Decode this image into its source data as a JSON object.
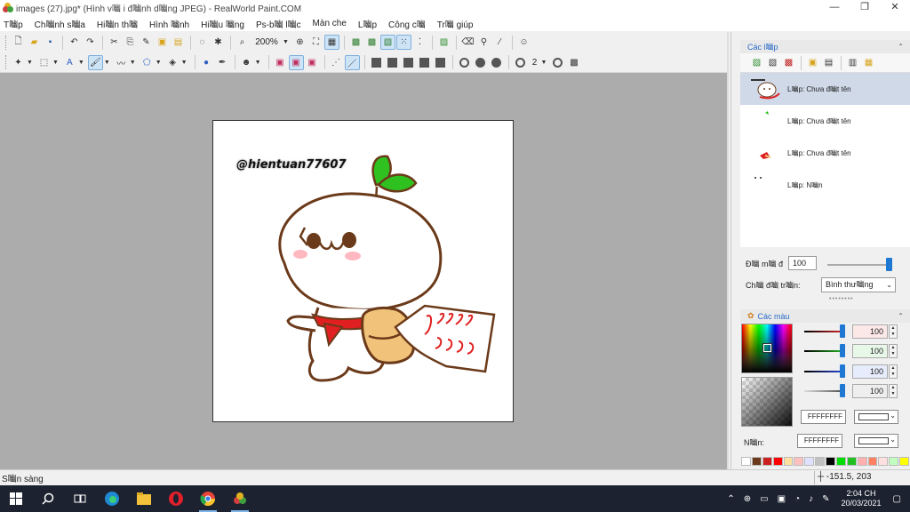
{
  "window": {
    "title": "images (27).jpg* (Hình v㗀 i đ㗀nh d㗀ng JPEG) - RealWorld Paint.COM",
    "controls": [
      "—",
      "❐",
      "✕"
    ]
  },
  "menu": [
    "T㗀p",
    "Ch㗀nh s㗀a",
    "Hi㗀n th㗀",
    "Hình 㗀nh",
    "Hi㗀u 㗀ng",
    "Ps-b㗀 l㗀c",
    "Màn che",
    "L㗀p",
    "Công c㗀",
    "Tr㗀 giúp"
  ],
  "toolbar1": {
    "zoom": "200%"
  },
  "toolbar2": {
    "brush_width": "2"
  },
  "canvas": {
    "watermark": "@hientuan77607"
  },
  "layers_panel": {
    "title": "Các l㗀p",
    "layers": [
      {
        "name": "L㗀p: Chưa đ㗀t tên",
        "selected": true
      },
      {
        "name": "L㗀p: Chưa đ㗀t tên",
        "selected": false
      },
      {
        "name": "L㗀p: Chưa đ㗀t tên",
        "selected": false
      },
      {
        "name": "L㗀p: N㗀n",
        "selected": false
      }
    ],
    "opacity_label": "Đ㗀 m㗀 đ",
    "opacity_value": "100",
    "blend_label": "Ch㗀 đ㗀 tr㗀n:",
    "blend_value": "Bình thư㗀ng"
  },
  "colors_panel": {
    "title": "Các màu",
    "channels": [
      {
        "value": "100",
        "color": "#cc2222",
        "bg": "#fde8e8"
      },
      {
        "value": "100",
        "color": "#22aa22",
        "bg": "#e8f8e8"
      },
      {
        "value": "100",
        "color": "#2244cc",
        "bg": "#e6ecfb"
      },
      {
        "value": "100",
        "color": "#888888",
        "bg": "#eeeeee"
      }
    ],
    "primary_hex": "FFFFFFFF",
    "background_label": "N㗀n:",
    "background_hex": "FFFFFFFF",
    "palette": [
      "#ffffff",
      "#6b3a1a",
      "#cc2020",
      "#ff0000",
      "#ffe0a0",
      "#ffc0c0",
      "#e0e0ff",
      "#c0c0c0",
      "#000000",
      "#00dd00",
      "#20c020",
      "#ffb0b0",
      "#ff8060",
      "#ffe0e0",
      "#c0ffc0",
      "#ffff00"
    ]
  },
  "status": {
    "text": "S㗀n sàng",
    "coords": "-151.5, 203"
  },
  "taskbar": {
    "time": "2:04 CH",
    "date": "20/03/2021"
  }
}
